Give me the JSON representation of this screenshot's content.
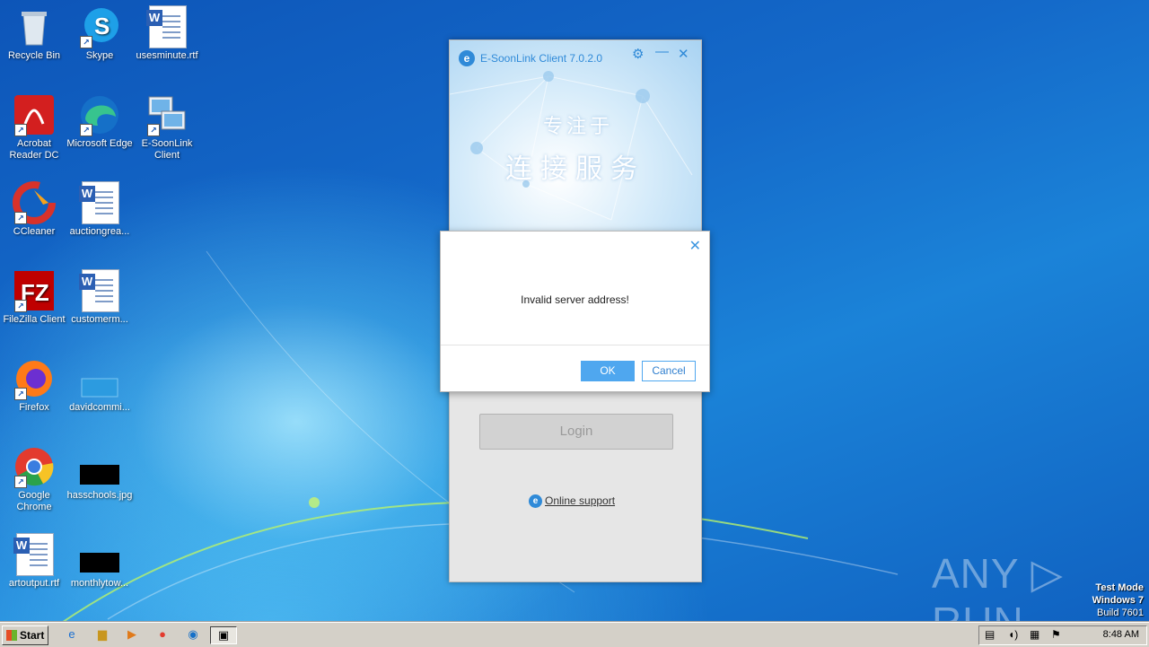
{
  "desktop": {
    "icons": [
      {
        "label": "Recycle Bin",
        "icon": "recycle-bin-icon"
      },
      {
        "label": "Skype",
        "icon": "skype-icon"
      },
      {
        "label": "usesminute.rtf",
        "icon": "word-doc-icon"
      },
      {
        "label": "Acrobat Reader DC",
        "icon": "acrobat-icon"
      },
      {
        "label": "Microsoft Edge",
        "icon": "edge-icon"
      },
      {
        "label": "E-SoonLink Client",
        "icon": "esoonlink-icon"
      },
      {
        "label": "CCleaner",
        "icon": "ccleaner-icon"
      },
      {
        "label": "auctiongrea...",
        "icon": "word-doc-icon"
      },
      {
        "label": "FileZilla Client",
        "icon": "filezilla-icon"
      },
      {
        "label": "customerm...",
        "icon": "word-doc-icon"
      },
      {
        "label": "Firefox",
        "icon": "firefox-icon"
      },
      {
        "label": "davidcommi...",
        "icon": "blank-file-icon"
      },
      {
        "label": "Google Chrome",
        "icon": "chrome-icon"
      },
      {
        "label": "hasschools.jpg",
        "icon": "image-file-icon"
      },
      {
        "label": "artoutput.rtf",
        "icon": "word-doc-icon"
      },
      {
        "label": "monthlytow...",
        "icon": "image-file-icon"
      }
    ]
  },
  "client": {
    "title": "E-SoonLink Client 7.0.2.0",
    "slogan_line1": "专注于",
    "slogan_line2": "连接服务",
    "login_label": "Login",
    "online_support": "Online support"
  },
  "dialog": {
    "message": "Invalid server address!",
    "ok_label": "OK",
    "cancel_label": "Cancel"
  },
  "taskbar": {
    "start_label": "Start",
    "clock": "8:48 AM"
  },
  "watermark": {
    "brand": "ANY ▷ RUN",
    "line1": "Test Mode",
    "line2": "Windows 7",
    "line3": "Build 7601"
  }
}
